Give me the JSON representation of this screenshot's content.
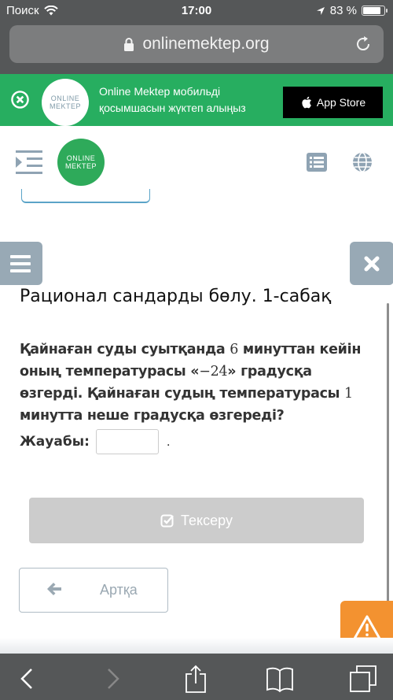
{
  "status_bar": {
    "carrier": "Поиск",
    "time": "17:00",
    "battery_percent_label": "83 %",
    "battery_level": 0.83,
    "icons": [
      "wifi-icon",
      "location-arrow-icon",
      "battery-icon"
    ]
  },
  "browser": {
    "url": "onlinemektep.org",
    "lock_icon": "lock-icon",
    "reload_icon": "reload-icon"
  },
  "app_banner": {
    "logo_line1": "ONLINE",
    "logo_line2": "MEKTEP",
    "text_line1": "Online Mektep мобильді",
    "text_line2": "қосымшасын жүктеп алыңыз",
    "store_button": "App Store",
    "colors": {
      "background": "#27ae60"
    }
  },
  "header": {
    "logo_line1": "ONLINE",
    "logo_line2": "MEKTEP",
    "colors": {
      "logo": "#2eaa5a",
      "icons": "#8fa3b3"
    }
  },
  "lesson": {
    "title": "Рационал сандарды бөлу. 1-сабақ",
    "question_parts": {
      "p1": "Қайнаған суды суытқанда ",
      "n1": "6",
      "p2": " минуттан кейін оның температурасы «",
      "n2": "−24",
      "p3": "» градусқа өзгерді. Қайнаған судың температурасы ",
      "n3": "1",
      "p4": " минутта неше градусқа өзгереді?"
    },
    "answer_label": "Жауабы:",
    "answer_value": "",
    "answer_suffix": ".",
    "check_button": "Тексеру",
    "back_button": "Артқа"
  },
  "colors": {
    "side_buttons": "#98a9b5",
    "check_button": "#cccccc",
    "report_button": "#f39230"
  }
}
